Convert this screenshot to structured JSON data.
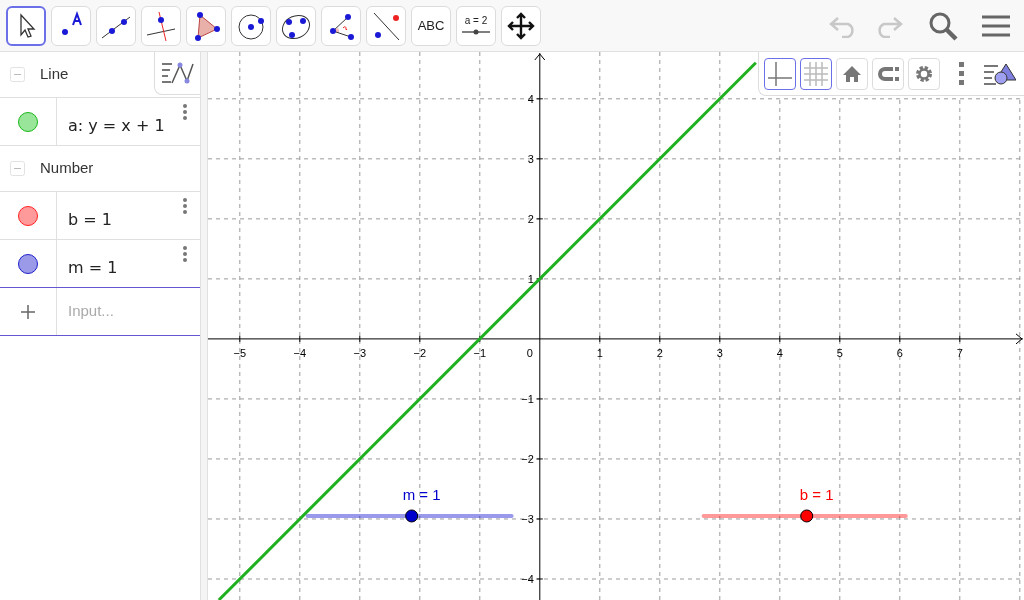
{
  "toolbar": {
    "tools": [
      {
        "kind": "move",
        "selected": true
      },
      {
        "kind": "point",
        "selected": false
      },
      {
        "kind": "line",
        "selected": false
      },
      {
        "kind": "perpendicular",
        "selected": false
      },
      {
        "kind": "polygon",
        "selected": false
      },
      {
        "kind": "circle",
        "selected": false
      },
      {
        "kind": "conic",
        "selected": false
      },
      {
        "kind": "angle",
        "selected": false
      },
      {
        "kind": "reflect",
        "selected": false
      },
      {
        "kind": "text",
        "label": "ABC",
        "selected": false
      },
      {
        "kind": "slider",
        "label": "a = 2",
        "selected": false
      },
      {
        "kind": "pan",
        "selected": false
      }
    ],
    "actions": [
      {
        "kind": "undo",
        "disabled": true
      },
      {
        "kind": "redo",
        "disabled": true
      },
      {
        "kind": "search",
        "disabled": false
      },
      {
        "kind": "menu",
        "disabled": false
      }
    ]
  },
  "algebra": {
    "groups": [
      {
        "title": "Line",
        "expanded": true,
        "items": [
          {
            "text": "a: y = x + 1",
            "color": "#99e599"
          }
        ]
      },
      {
        "title": "Number",
        "expanded": true,
        "items": [
          {
            "text": "b = 1",
            "color": "#ff9a9a"
          },
          {
            "text": "m = 1",
            "color": "#9a9ae8"
          }
        ]
      }
    ],
    "input": {
      "placeholder": "Input..."
    }
  },
  "graphics": {
    "style_bar": [
      {
        "kind": "axes",
        "selected": true
      },
      {
        "kind": "grid",
        "selected": true
      },
      {
        "kind": "home",
        "selected": false
      },
      {
        "kind": "magnet",
        "selected": false
      },
      {
        "kind": "settings",
        "selected": false
      }
    ],
    "chart_data": {
      "type": "line",
      "grid": true,
      "x": [
        -5.35,
        3.6
      ],
      "series": [
        {
          "color": "#1fb01f",
          "values": [
            -4.35,
            4.6
          ]
        }
      ],
      "xlim": [
        -5.53,
        8.07
      ],
      "ylim": [
        -4.35,
        4.78
      ],
      "xticks": [
        {
          "value": -5,
          "label": "−5"
        },
        {
          "value": -4,
          "label": "−4"
        },
        {
          "value": -3,
          "label": "−3"
        },
        {
          "value": -2,
          "label": "−2"
        },
        {
          "value": -1,
          "label": "−1"
        },
        {
          "value": 1,
          "label": "1"
        },
        {
          "value": 2,
          "label": "2"
        },
        {
          "value": 3,
          "label": "3"
        },
        {
          "value": 4,
          "label": "4"
        },
        {
          "value": 5,
          "label": "5"
        },
        {
          "value": 6,
          "label": "6"
        },
        {
          "value": 7,
          "label": "7"
        }
      ],
      "yticks": [
        {
          "value": -4,
          "label": "−4"
        },
        {
          "value": -3,
          "label": "−3"
        },
        {
          "value": -2,
          "label": "−2"
        },
        {
          "value": -1,
          "label": "−1"
        },
        {
          "value": 1,
          "label": "1"
        },
        {
          "value": 2,
          "label": "2"
        },
        {
          "value": 3,
          "label": "3"
        },
        {
          "value": 4,
          "label": "4"
        }
      ]
    },
    "origin_label": "0",
    "sliders": [
      {
        "label": "m = 1",
        "color": "#0000cc",
        "level": 0.51
      },
      {
        "label": "b = 1",
        "color": "#ff0000",
        "level": 0.51
      }
    ]
  }
}
